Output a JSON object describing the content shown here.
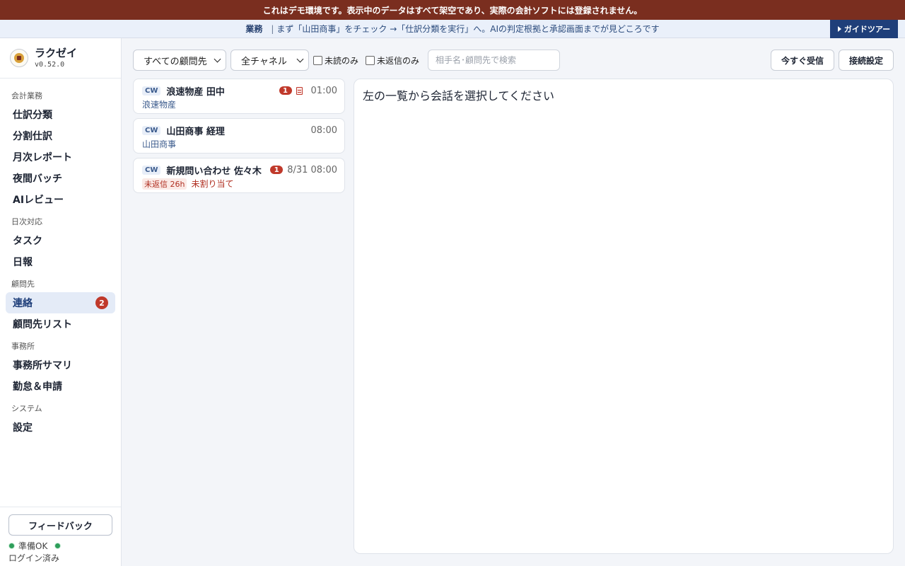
{
  "banner": {
    "text": "これはデモ環境です。表示中のデータはすべて架空であり、実際の会計ソフトには登録されません。"
  },
  "guide": {
    "tag": "業務",
    "sep": "|",
    "text": "まず「山田商事」をチェック →「仕訳分類を実行」へ。AIの判定根拠と承認画面までが見どころです",
    "tour_label": "ガイドツアー"
  },
  "brand": {
    "name": "ラクゼイ",
    "version": "v0.52.0"
  },
  "nav": {
    "sections": [
      {
        "label": "会計業務",
        "items": [
          {
            "label": "仕訳分類"
          },
          {
            "label": "分割仕訳"
          },
          {
            "label": "月次レポート"
          },
          {
            "label": "夜間バッチ"
          },
          {
            "label": "AIレビュー"
          }
        ]
      },
      {
        "label": "日次対応",
        "items": [
          {
            "label": "タスク"
          },
          {
            "label": "日報"
          }
        ]
      },
      {
        "label": "顧問先",
        "items": [
          {
            "label": "連絡",
            "badge": "2",
            "active": true
          },
          {
            "label": "顧問先リスト"
          }
        ]
      },
      {
        "label": "事務所",
        "items": [
          {
            "label": "事務所サマリ"
          },
          {
            "label": "勤怠＆申請"
          }
        ]
      },
      {
        "label": "システム",
        "items": [
          {
            "label": "設定"
          }
        ]
      }
    ]
  },
  "footer": {
    "feedback_label": "フィードバック",
    "status_label": "準備OK",
    "login_label": "ログイン済み"
  },
  "toolbar": {
    "client_select": "すべての顧問先",
    "channel_select": "全チャネル",
    "unread_only": "未読のみ",
    "unreplied_only": "未返信のみ",
    "search_placeholder": "相手名･顧問先で検索",
    "receive_now": "今すぐ受信",
    "connection_settings": "接続設定"
  },
  "conversations": [
    {
      "channel": "CW",
      "name": "浪速物産 田中",
      "unread": "1",
      "has_memo": true,
      "time": "01:00",
      "sub": "浪速物産"
    },
    {
      "channel": "CW",
      "name": "山田商事 経理",
      "unread": "",
      "has_memo": false,
      "time": "08:00",
      "sub": "山田商事"
    },
    {
      "channel": "CW",
      "name": "新規問い合わせ 佐々木",
      "unread": "1",
      "has_memo": false,
      "time": "8/31 08:00",
      "warn": "未返信 26h",
      "assign": "未割り当て"
    }
  ],
  "detail": {
    "empty_text": "左の一覧から会話を選択してください"
  }
}
